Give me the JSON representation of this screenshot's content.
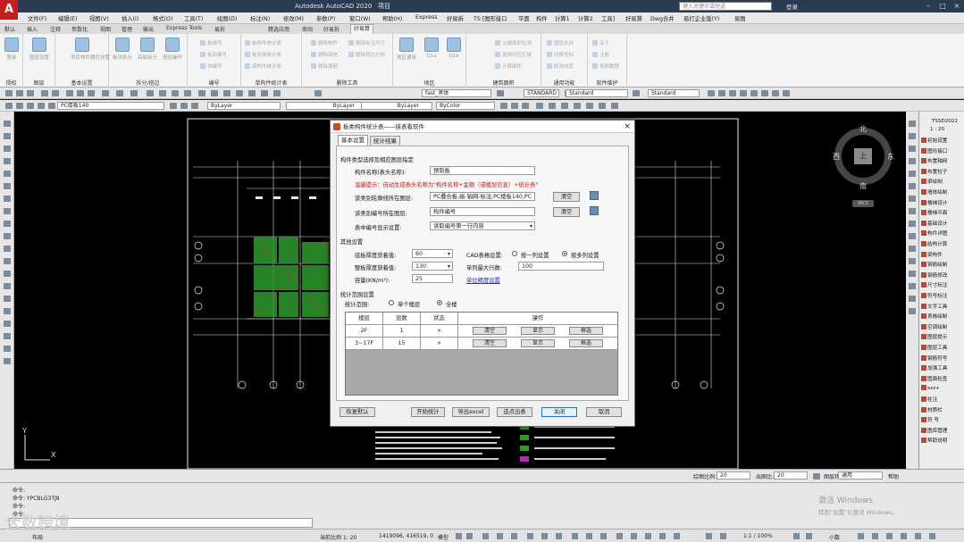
{
  "app": {
    "title": "Autodesk AutoCAD 2020",
    "title_suffix": "项目",
    "search_placeholder": "键入关键字或短语",
    "login": "登录"
  },
  "menu": [
    "文件(F)",
    "编辑(E)",
    "视图(V)",
    "插入(I)",
    "格式(O)",
    "工具(T)",
    "绘图(D)",
    "标注(N)",
    "修改(M)",
    "参数(P)",
    "窗口(W)",
    "帮助(H)",
    "Express",
    "好易拆",
    "TS [图形接口",
    "平面",
    "构件",
    "计算1",
    "计算2",
    "工具]",
    "好易算",
    "Dwg合并",
    "易打企业版(Y)",
    "易图"
  ],
  "ribbon_tabs": [
    "默认",
    "插入",
    "注释",
    "参数化",
    "视图",
    "管理",
    "输出",
    "Express Tools",
    "易拆",
    "精选应用",
    "审阅",
    "好易拆",
    "好易算"
  ],
  "ribbon_groups": [
    {
      "label": "授权",
      "buttons": [
        "登录"
      ]
    },
    {
      "label": "图层",
      "buttons": [
        "图层设置"
      ]
    },
    {
      "label": "基本设置",
      "buttons": [
        "项目构件属性设置"
      ]
    },
    {
      "label": "拆分/搭边",
      "buttons": [
        "板块拆分",
        "高级拆分",
        "搭边操作"
      ]
    },
    {
      "label": "编号",
      "small": [
        "板编号",
        "板后编号",
        "块编号"
      ]
    },
    {
      "label": "单构件统计表",
      "small": [
        "板构件统计表",
        "板实体统计表",
        "梁构件统计表"
      ]
    },
    {
      "label": "删除工具",
      "small": [
        "删除构件",
        "删除标注尺寸",
        "删除填充",
        "删除搭边方向",
        "删除钢筋",
        "删除钢筋构"
      ]
    },
    {
      "label": "地区",
      "buttons": [
        "地区通用",
        "Q1a",
        "Q1b"
      ]
    },
    {
      "label": "建筑面积",
      "small": [
        "公摊面积检测",
        "选择对应区域",
        "计算面积"
      ]
    },
    {
      "label": "通用功能",
      "small": [
        "图层合并",
        "切换坐标",
        "修改线宽"
      ]
    },
    {
      "label": "软件维护",
      "small": [
        "关于",
        "注册",
        "视频教程"
      ]
    }
  ],
  "toolbar2": {
    "text_style": "fast_黑体",
    "dim_style": "STANDARD",
    "table_style": "Standard",
    "multileader_style": "Standard"
  },
  "toolbar3": {
    "layer": "PC楼板140",
    "color": "ByLayer",
    "linetype": "ByLayer",
    "lineweight": "ByLayer",
    "plotstyle": "ByColor"
  },
  "compass": {
    "north": "北",
    "south": "南",
    "east": "东",
    "west": "西",
    "center": "上",
    "wcs": "WCS"
  },
  "ucs": {
    "x": "X",
    "y": "Y"
  },
  "right_panel": {
    "title": "TSSD2022",
    "ratio": "1 : 20",
    "items": [
      "初始设置",
      "图形接口",
      "布置轴网",
      "布置柱子",
      "梁绘制",
      "墙体绘制",
      "楼梯设计",
      "楼梯平面",
      "基础设计",
      "构件详图",
      "结构计算",
      "梁构件",
      "钢筋绘制",
      "钢筋修改",
      "尺寸标注",
      "符号标注",
      "文字工具",
      "表格绘制",
      "空调绘制",
      "图层提示",
      "图层工具",
      "钢筋符号",
      "加强工具",
      "图面检查",
      "xzz+",
      "柱注",
      "材质栏",
      "符 号",
      "图库管理",
      "帮助说明"
    ]
  },
  "dialog": {
    "title": "板类构件统计表——抹表看软件",
    "close": "×",
    "tabs": [
      "基本设置",
      "统计结果"
    ],
    "section1": "构件类型选择及相应图层指定",
    "name_label": "构件名称(表头名称):",
    "name_value": "预制板",
    "warning": "温馨提示：自动生成表头名称为\"构件名称+金额（或楼层信息）+统计表\"",
    "outline_label": "该类别轮廓线所在图层:",
    "outline_value": "PC叠合板,磁-轴网-标注,PC楼板140,PC",
    "number_label": "该类别编号所在图层:",
    "number_value": "构件编号",
    "display_label": "表中编号显示设置:",
    "display_value": "读取编号第一行内容",
    "clear": "清空",
    "section2": "其他设置",
    "base_thk_label": "底板厚度获着值:",
    "base_thk_value": "60",
    "total_thk_label": "整板厚度获着值:",
    "total_thk_value": "130",
    "density_label": "容量(KN/m³):",
    "density_value": "25",
    "cad_label": "CAD表格设置:",
    "cad_opt1": "按一列设置",
    "cad_opt2": "按多列设置",
    "rows_label": "单列最大行数:",
    "rows_value": "100",
    "unit_link": "单位精度设置",
    "section3": "统计范围设置",
    "range_label": "统计范围:",
    "range_opt1": "单个楼层",
    "range_opt2": "全楼",
    "table": {
      "headers": [
        "楼层",
        "层数",
        "状态",
        "操作"
      ],
      "rows": [
        {
          "floor": "2F",
          "count": "1",
          "status": "×",
          "ops": [
            "清空",
            "显示",
            "框选"
          ]
        },
        {
          "floor": "3~17F",
          "count": "15",
          "status": "×",
          "ops": [
            "清空",
            "显示",
            "框选"
          ]
        }
      ]
    },
    "buttons": [
      "恢复默认",
      "开始统计",
      "导出excel",
      "选点出表",
      "关闭",
      "取消"
    ]
  },
  "model_tabs": {
    "drawing_label": "绘图比例:",
    "drawing_value": "20",
    "out_label": "出图比:",
    "out_value": "20",
    "status_label": "图层状态",
    "status_value": "通用",
    "help": "帮助"
  },
  "command": {
    "line1": "命令:",
    "line2": "命令: YPCBLG3TJ8",
    "line3": "命令:",
    "line4": "命令:"
  },
  "activate": {
    "main": "激活 Windows",
    "sub": "转到\"设置\"以激活 Windows。"
  },
  "status": {
    "scale_label": "当前比例 1: 20",
    "coords": "1419096, 416519, 0",
    "model": "模型",
    "zoom": "1:1 / 100%",
    "units": "小数",
    "layout": "布局"
  },
  "watermark": "大数跨境",
  "colors": {
    "titlebar": "#2b3c52",
    "logo": "#c41e1e",
    "canvas": "#000000",
    "warning": "#d01010",
    "link": "#1a33c0"
  }
}
